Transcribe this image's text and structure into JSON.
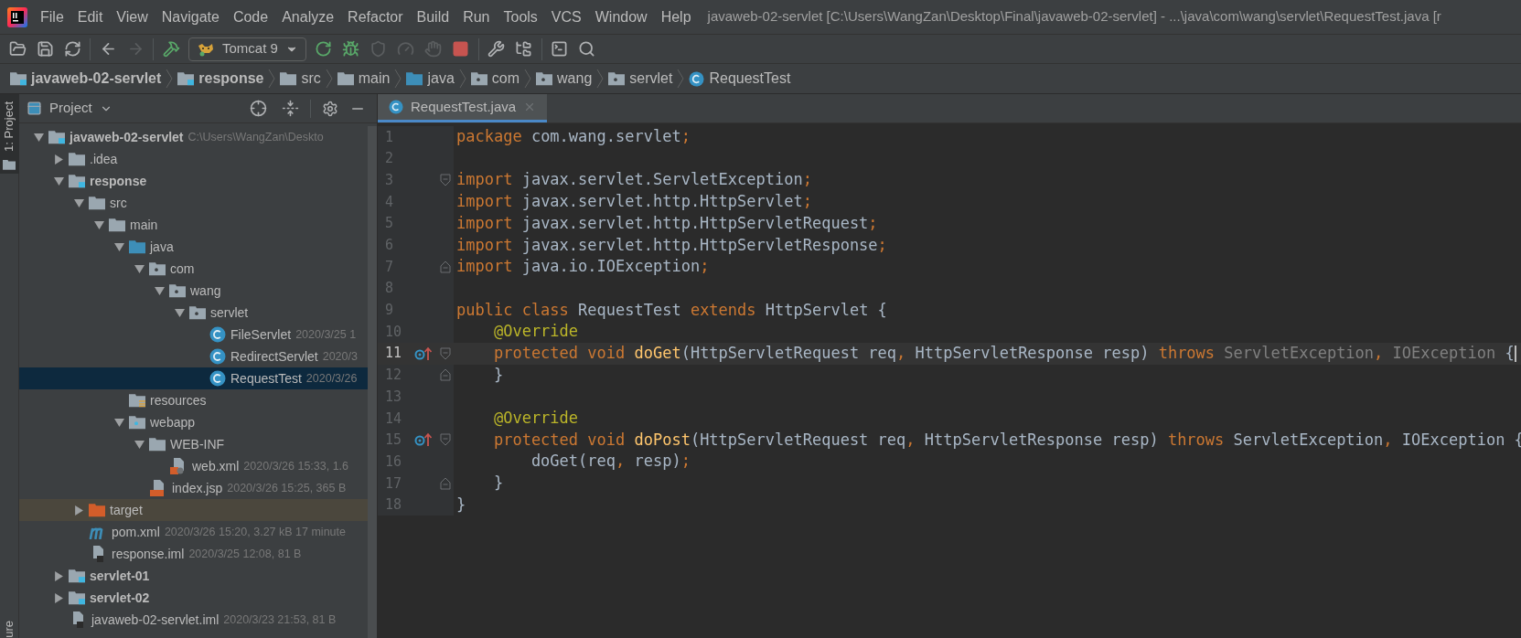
{
  "window": {
    "title": "javaweb-02-servlet [C:\\Users\\WangZan\\Desktop\\Final\\javaweb-02-servlet] - ...\\java\\com\\wang\\servlet\\RequestTest.java [r"
  },
  "menu": [
    "File",
    "Edit",
    "View",
    "Navigate",
    "Code",
    "Analyze",
    "Refactor",
    "Build",
    "Run",
    "Tools",
    "VCS",
    "Window",
    "Help"
  ],
  "toolbar": [
    {
      "kind": "open",
      "disabled": false
    },
    {
      "kind": "save",
      "disabled": false
    },
    {
      "kind": "sync",
      "disabled": false
    },
    {
      "kind": "separator"
    },
    {
      "kind": "back",
      "disabled": false
    },
    {
      "kind": "forward",
      "disabled": true
    },
    {
      "kind": "separator"
    },
    {
      "kind": "build",
      "disabled": false
    },
    {
      "kind": "run-config",
      "label": "Tomcat 9",
      "disabled": false
    },
    {
      "kind": "rerun",
      "disabled": false
    },
    {
      "kind": "debug",
      "disabled": false
    },
    {
      "kind": "coverage",
      "disabled": true
    },
    {
      "kind": "profile",
      "disabled": true
    },
    {
      "kind": "attach",
      "disabled": true
    },
    {
      "kind": "stop",
      "disabled": false
    },
    {
      "kind": "separator"
    },
    {
      "kind": "wrench",
      "disabled": false
    },
    {
      "kind": "structure",
      "disabled": false
    },
    {
      "kind": "separator"
    },
    {
      "kind": "terminal",
      "disabled": false
    },
    {
      "kind": "search",
      "disabled": false
    }
  ],
  "breadcrumbs": [
    {
      "label": "javaweb-02-servlet",
      "kind": "module"
    },
    {
      "label": "response",
      "kind": "module"
    },
    {
      "label": "src",
      "kind": "folder"
    },
    {
      "label": "main",
      "kind": "folder"
    },
    {
      "label": "java",
      "kind": "source-folder"
    },
    {
      "label": "com",
      "kind": "package"
    },
    {
      "label": "wang",
      "kind": "package"
    },
    {
      "label": "servlet",
      "kind": "package"
    },
    {
      "label": "RequestTest",
      "kind": "class"
    }
  ],
  "side_strip": {
    "top": "1: Project",
    "bottom": "ure"
  },
  "project_panel": {
    "title": "Project",
    "tree": [
      {
        "label": "javaweb-02-servlet",
        "detail": "C:\\Users\\WangZan\\Deskto",
        "kind": "module",
        "expanded": true,
        "selected": false,
        "children": [
          {
            "label": ".idea",
            "kind": "folder",
            "expanded": false,
            "selected": false
          },
          {
            "label": "response",
            "kind": "module",
            "expanded": true,
            "selected": false,
            "children": [
              {
                "label": "src",
                "kind": "folder",
                "expanded": true,
                "selected": false,
                "children": [
                  {
                    "label": "main",
                    "kind": "folder",
                    "expanded": true,
                    "selected": false,
                    "children": [
                      {
                        "label": "java",
                        "kind": "source-folder",
                        "expanded": true,
                        "selected": false,
                        "children": [
                          {
                            "label": "com",
                            "kind": "package",
                            "expanded": true,
                            "selected": false,
                            "children": [
                              {
                                "label": "wang",
                                "kind": "package",
                                "expanded": true,
                                "selected": false,
                                "children": [
                                  {
                                    "label": "servlet",
                                    "kind": "package",
                                    "expanded": true,
                                    "selected": false,
                                    "children": [
                                      {
                                        "label": "FileServlet",
                                        "detail": "2020/3/25 1",
                                        "kind": "class",
                                        "selected": false
                                      },
                                      {
                                        "label": "RedirectServlet",
                                        "detail": "2020/3",
                                        "kind": "class",
                                        "selected": false
                                      },
                                      {
                                        "label": "RequestTest",
                                        "detail": "2020/3/26",
                                        "kind": "class",
                                        "selected": true
                                      }
                                    ]
                                  }
                                ]
                              }
                            ]
                          }
                        ]
                      },
                      {
                        "label": "resources",
                        "kind": "resources-folder",
                        "selected": false
                      },
                      {
                        "label": "webapp",
                        "kind": "web-folder",
                        "expanded": true,
                        "selected": false,
                        "children": [
                          {
                            "label": "WEB-INF",
                            "kind": "folder",
                            "expanded": true,
                            "selected": false,
                            "children": [
                              {
                                "label": "web.xml",
                                "detail": "2020/3/26 15:33, 1.6",
                                "kind": "xml",
                                "selected": false
                              }
                            ]
                          },
                          {
                            "label": "index.jsp",
                            "detail": "2020/3/26 15:25, 365 B",
                            "kind": "jsp",
                            "selected": false
                          }
                        ]
                      }
                    ]
                  }
                ]
              },
              {
                "label": "target",
                "kind": "excluded-folder",
                "expanded": false,
                "selected": false
              },
              {
                "label": "pom.xml",
                "detail": "2020/3/26 15:20, 3.27 kB 17 minute",
                "kind": "maven",
                "selected": false
              },
              {
                "label": "response.iml",
                "detail": "2020/3/25 12:08, 81 B",
                "kind": "iml",
                "selected": false
              }
            ]
          },
          {
            "label": "servlet-01",
            "kind": "module",
            "expanded": false,
            "selected": false
          },
          {
            "label": "servlet-02",
            "kind": "module",
            "expanded": false,
            "selected": false
          },
          {
            "label": "javaweb-02-servlet.iml",
            "detail": "2020/3/23 21:53, 81 B",
            "kind": "iml",
            "selected": false
          }
        ]
      }
    ]
  },
  "editor": {
    "tabs": [
      {
        "label": "RequestTest.java",
        "selected": true
      }
    ],
    "lines": [
      {
        "number": "1",
        "current": false,
        "override_marker": false,
        "fold_open": false,
        "fold_close": false,
        "tokens": [
          {
            "t": "package ",
            "kind": "keyword"
          },
          {
            "t": "com.wang.servlet",
            "kind": "plain"
          },
          {
            "t": ";",
            "kind": "punct"
          }
        ]
      },
      {
        "number": "2",
        "current": false,
        "override_marker": false,
        "fold_open": false,
        "fold_close": false
      },
      {
        "number": "3",
        "current": false,
        "override_marker": false,
        "fold_open": true,
        "fold_close": false,
        "tokens": [
          {
            "t": "import ",
            "kind": "keyword"
          },
          {
            "t": "javax.servlet.ServletException",
            "kind": "plain"
          },
          {
            "t": ";",
            "kind": "punct"
          }
        ]
      },
      {
        "number": "4",
        "current": false,
        "override_marker": false,
        "fold_open": false,
        "fold_close": false,
        "tokens": [
          {
            "t": "import ",
            "kind": "keyword"
          },
          {
            "t": "javax.servlet.http.HttpServlet",
            "kind": "plain"
          },
          {
            "t": ";",
            "kind": "punct"
          }
        ]
      },
      {
        "number": "5",
        "current": false,
        "override_marker": false,
        "fold_open": false,
        "fold_close": false,
        "tokens": [
          {
            "t": "import ",
            "kind": "keyword"
          },
          {
            "t": "javax.servlet.http.HttpServletRequest",
            "kind": "plain"
          },
          {
            "t": ";",
            "kind": "punct"
          }
        ]
      },
      {
        "number": "6",
        "current": false,
        "override_marker": false,
        "fold_open": false,
        "fold_close": false,
        "tokens": [
          {
            "t": "import ",
            "kind": "keyword"
          },
          {
            "t": "javax.servlet.http.HttpServletResponse",
            "kind": "plain"
          },
          {
            "t": ";",
            "kind": "punct"
          }
        ]
      },
      {
        "number": "7",
        "current": false,
        "override_marker": false,
        "fold_open": false,
        "fold_close": true,
        "tokens": [
          {
            "t": "import ",
            "kind": "keyword"
          },
          {
            "t": "java.io.IOException",
            "kind": "plain"
          },
          {
            "t": ";",
            "kind": "punct"
          }
        ]
      },
      {
        "number": "8",
        "current": false,
        "override_marker": false,
        "fold_open": false,
        "fold_close": false
      },
      {
        "number": "9",
        "current": false,
        "override_marker": false,
        "fold_open": false,
        "fold_close": false,
        "tokens": [
          {
            "t": "public class ",
            "kind": "keyword"
          },
          {
            "t": "RequestTest ",
            "kind": "plain"
          },
          {
            "t": "extends ",
            "kind": "keyword"
          },
          {
            "t": "HttpServlet {",
            "kind": "plain"
          }
        ]
      },
      {
        "number": "10",
        "current": false,
        "override_marker": false,
        "fold_open": false,
        "fold_close": false,
        "tokens": [
          {
            "t": "    @Override",
            "kind": "annotation"
          }
        ]
      },
      {
        "number": "11",
        "current": true,
        "override_marker": true,
        "fold_open": true,
        "fold_close": false,
        "tokens": [
          {
            "t": "    protected void ",
            "kind": "keyword"
          },
          {
            "t": "doGet",
            "kind": "method"
          },
          {
            "t": "(HttpServletRequest req",
            "kind": "plain"
          },
          {
            "t": ", ",
            "kind": "punct"
          },
          {
            "t": "HttpServletResponse resp) ",
            "kind": "plain"
          },
          {
            "t": "throws ",
            "kind": "keyword"
          },
          {
            "t": "ServletException",
            "kind": "unused"
          },
          {
            "t": ", ",
            "kind": "punct"
          },
          {
            "t": "IOException ",
            "kind": "unused"
          },
          {
            "t": "{",
            "kind": "plain"
          }
        ]
      },
      {
        "number": "12",
        "current": false,
        "override_marker": false,
        "fold_open": false,
        "fold_close": true,
        "tokens": [
          {
            "t": "    }",
            "kind": "plain"
          }
        ]
      },
      {
        "number": "13",
        "current": false,
        "override_marker": false,
        "fold_open": false,
        "fold_close": false
      },
      {
        "number": "14",
        "current": false,
        "override_marker": false,
        "fold_open": false,
        "fold_close": false,
        "tokens": [
          {
            "t": "    @Override",
            "kind": "annotation"
          }
        ]
      },
      {
        "number": "15",
        "current": false,
        "override_marker": true,
        "fold_open": true,
        "fold_close": false,
        "tokens": [
          {
            "t": "    protected void ",
            "kind": "keyword"
          },
          {
            "t": "doPost",
            "kind": "method"
          },
          {
            "t": "(HttpServletRequest req",
            "kind": "plain"
          },
          {
            "t": ", ",
            "kind": "punct"
          },
          {
            "t": "HttpServletResponse resp) ",
            "kind": "plain"
          },
          {
            "t": "throws ",
            "kind": "keyword"
          },
          {
            "t": "ServletException",
            "kind": "plain"
          },
          {
            "t": ", ",
            "kind": "punct"
          },
          {
            "t": "IOException {",
            "kind": "plain"
          }
        ]
      },
      {
        "number": "16",
        "current": false,
        "override_marker": false,
        "fold_open": false,
        "fold_close": false,
        "tokens": [
          {
            "t": "        doGet(req",
            "kind": "plain"
          },
          {
            "t": ", ",
            "kind": "punct"
          },
          {
            "t": "resp)",
            "kind": "plain"
          },
          {
            "t": ";",
            "kind": "punct"
          }
        ]
      },
      {
        "number": "17",
        "current": false,
        "override_marker": false,
        "fold_open": false,
        "fold_close": true,
        "tokens": [
          {
            "t": "    }",
            "kind": "plain"
          }
        ]
      },
      {
        "number": "18",
        "current": false,
        "override_marker": false,
        "fold_open": false,
        "fold_close": false,
        "tokens": [
          {
            "t": "}",
            "kind": "plain"
          }
        ]
      }
    ]
  }
}
